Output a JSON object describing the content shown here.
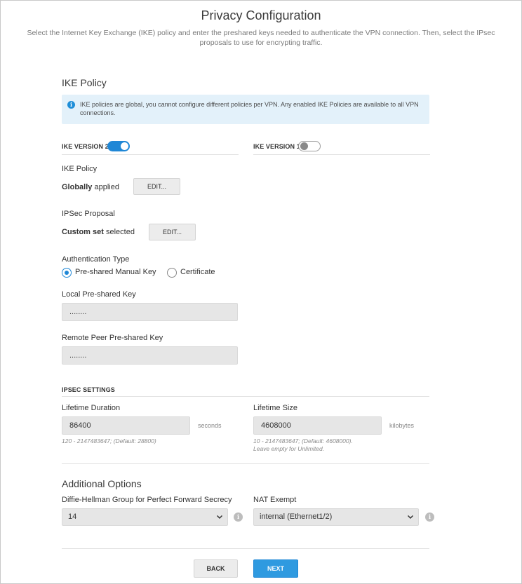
{
  "header": {
    "title": "Privacy Configuration",
    "description": "Select the Internet Key Exchange (IKE) policy and enter the preshared keys needed to authenticate the VPN connection. Then, select the IPsec proposals to use for encrypting traffic."
  },
  "ike": {
    "section_title": "IKE Policy",
    "info_text": "IKE policies are global, you cannot configure different policies per VPN. Any enabled IKE Policies are available to all VPN connections.",
    "info_icon": "info-icon",
    "v2_label": "IKE VERSION 2",
    "v2_enabled": true,
    "v1_label": "IKE VERSION 1",
    "v1_enabled": false,
    "policy_label": "IKE Policy",
    "policy_value_bold": "Globally",
    "policy_value_rest": " applied",
    "policy_edit": "EDIT...",
    "proposal_label": "IPSec Proposal",
    "proposal_value_bold": "Custom set",
    "proposal_value_rest": " selected",
    "proposal_edit": "EDIT...",
    "auth_label": "Authentication Type",
    "auth_options": [
      "Pre-shared Manual Key",
      "Certificate"
    ],
    "auth_selected": "Pre-shared Manual Key",
    "local_key_label": "Local Pre-shared Key",
    "local_key_value": "........",
    "remote_key_label": "Remote Peer Pre-shared Key",
    "remote_key_value": "........"
  },
  "ipsec": {
    "section_title": "IPSEC SETTINGS",
    "lifetime_duration_label": "Lifetime Duration",
    "lifetime_duration_value": "86400",
    "lifetime_duration_unit": "seconds",
    "lifetime_duration_hint": "120 - 2147483647; (Default: 28800)",
    "lifetime_size_label": "Lifetime Size",
    "lifetime_size_value": "4608000",
    "lifetime_size_unit": "kilobytes",
    "lifetime_size_hint_1": "10 - 2147483647; (Default: 4608000).",
    "lifetime_size_hint_2": "Leave empty for Unlimited."
  },
  "additional": {
    "section_title": "Additional Options",
    "dh_label": "Diffie-Hellman Group for Perfect Forward Secrecy",
    "dh_value": "14",
    "nat_label": "NAT Exempt",
    "nat_value": "internal (Ethernet1/2)",
    "info_glyph": "i"
  },
  "footer": {
    "back_label": "BACK",
    "next_label": "NEXT"
  },
  "colors": {
    "accent": "#1f87d6",
    "info_bg": "#e3f1fa",
    "next_bg": "#2f9ae0"
  }
}
